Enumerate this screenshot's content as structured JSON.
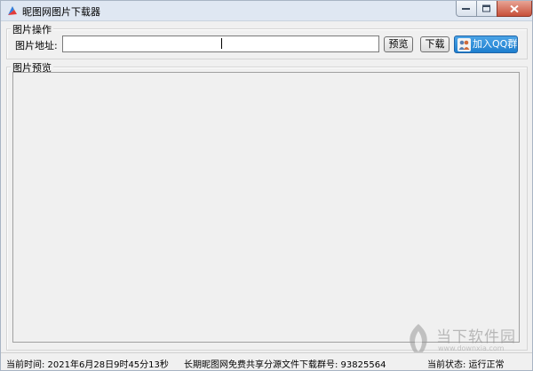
{
  "window": {
    "title": "昵图网图片下载器"
  },
  "operations": {
    "group_title": "图片操作",
    "url_label": "图片地址:",
    "url_value": "",
    "preview_button": "预览",
    "download_button": "下载",
    "qq_button": "加入QQ群"
  },
  "preview": {
    "group_title": "图片预览"
  },
  "status": {
    "time": "当前时间: 2021年6月28日9时45分13秒",
    "group_info": "长期昵图网免费共享分源文件下载群号: 93825564",
    "state": "当前状态: 运行正常"
  },
  "watermark": {
    "text": "当下软件园",
    "url": "www.downxia.com"
  },
  "colors": {
    "qq_button": "#1e7fcf",
    "titlebar": "#dfe7f2",
    "close_button": "#c7503a"
  }
}
